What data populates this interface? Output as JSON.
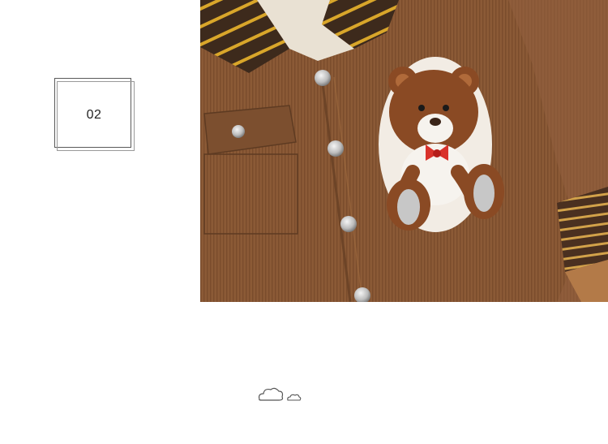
{
  "badge": {
    "number": "02"
  },
  "photo": {
    "subject_icon": "teddy-bear-patch-icon",
    "colors": {
      "corduroy": "#8b5a36",
      "corduroy_dark": "#6d4427",
      "stripe_dark": "#3d2a1c",
      "stripe_yellow": "#d9a62a",
      "fleece": "#e9e1d3",
      "bear_fur": "#8a4a24",
      "bow": "#d9322b",
      "button": "#c9c9c9"
    }
  },
  "decoration": {
    "icon": "clouds-icon"
  }
}
